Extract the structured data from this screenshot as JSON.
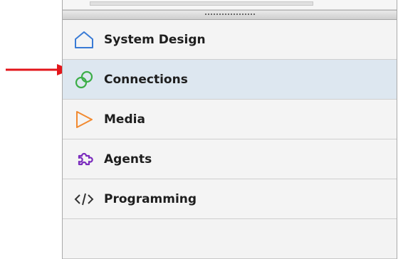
{
  "menu": {
    "items": [
      {
        "label": "System Design",
        "icon": "house-icon",
        "color": "#3a7bd5"
      },
      {
        "label": "Connections",
        "icon": "link-icon",
        "color": "#3cae48",
        "selected": true
      },
      {
        "label": "Media",
        "icon": "play-icon",
        "color": "#f28a30"
      },
      {
        "label": "Agents",
        "icon": "puzzle-icon",
        "color": "#7a2bbd"
      },
      {
        "label": "Programming",
        "icon": "code-icon",
        "color": "#333333"
      }
    ]
  },
  "annotation": {
    "arrow_color": "#e3161b",
    "points_to": "Connections"
  }
}
